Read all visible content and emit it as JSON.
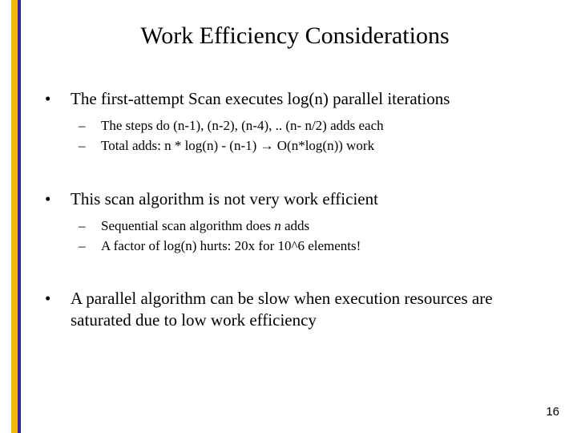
{
  "slide": {
    "title": "Work Efficiency Considerations",
    "bullets": [
      {
        "text": "The first-attempt Scan executes log(n) parallel iterations",
        "sub": [
          "The steps do (n-1), (n-2), (n-4), .. (n- n/2) adds each",
          "Total adds: n * log(n)  - (n-1) → O(n*log(n)) work"
        ]
      },
      {
        "text": "This scan algorithm is not very work efficient",
        "sub_pre_italic": "Sequential scan algorithm does ",
        "sub_italic": "n",
        "sub_post_italic": " adds",
        "sub2": "A factor of log(n) hurts: 20x for 10^6 elements!"
      },
      {
        "text": "A parallel algorithm can be slow when execution resources are saturated due to low work efficiency",
        "sub": []
      }
    ],
    "page_number": "16"
  }
}
